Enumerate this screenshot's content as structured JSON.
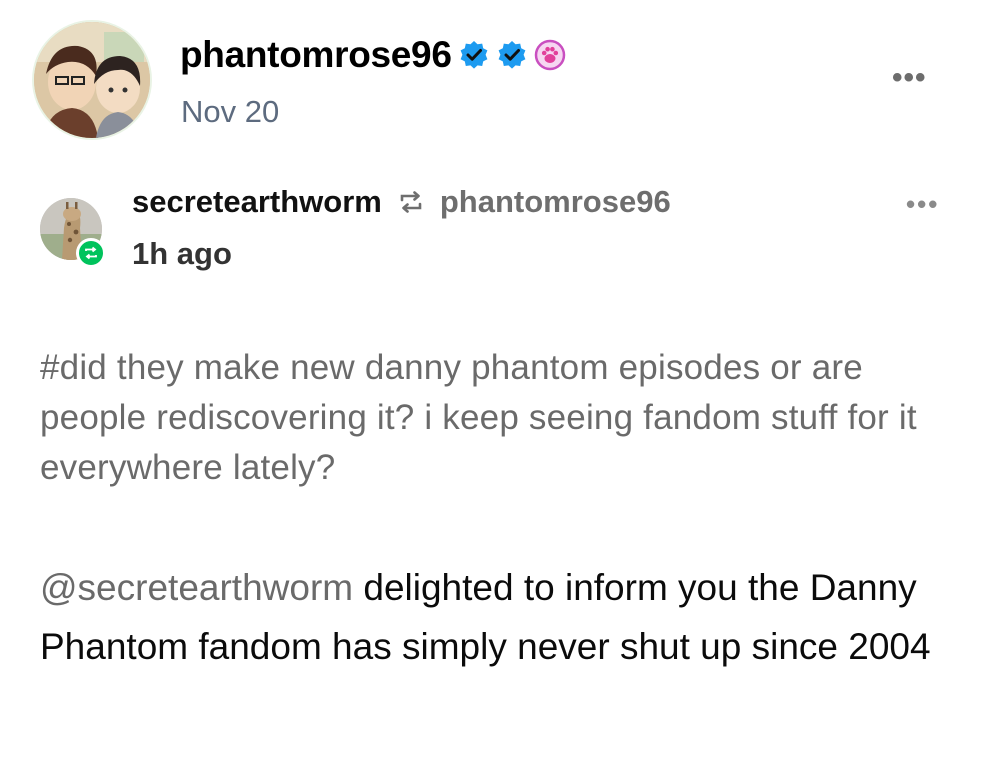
{
  "post": {
    "author": "phantomrose96",
    "date": "Nov 20",
    "avatar_icon": "anime-characters-avatar",
    "badges": [
      {
        "icon": "verified-check-badge-icon",
        "color": "#1d9bf0"
      },
      {
        "icon": "verified-check-badge-icon",
        "color": "#1d9bf0"
      },
      {
        "icon": "paw-badge-icon",
        "color": "#c94fc0"
      }
    ],
    "more_icon": "ellipsis-icon"
  },
  "reblog": {
    "user": "secretearthworm",
    "source": "phantomrose96",
    "time": "1h ago",
    "avatar_icon": "giraffe-avatar",
    "reblog_icon": "reblog-arrows-icon",
    "reblog_badge_color": "#00c35c",
    "more_icon": "ellipsis-icon"
  },
  "tags": "#did they make new danny phantom episodes or are people rediscovering it? i keep seeing fandom stuff for it everywhere lately?",
  "reply": {
    "mention": "@secretearthworm",
    "text": " delighted to inform you the Danny Phantom fandom has simply never shut up since 2004"
  },
  "colors": {
    "muted_text": "#6a6a6a",
    "date_text": "#5d6b7f",
    "accent_blue": "#1d9bf0",
    "accent_green": "#00c35c"
  }
}
